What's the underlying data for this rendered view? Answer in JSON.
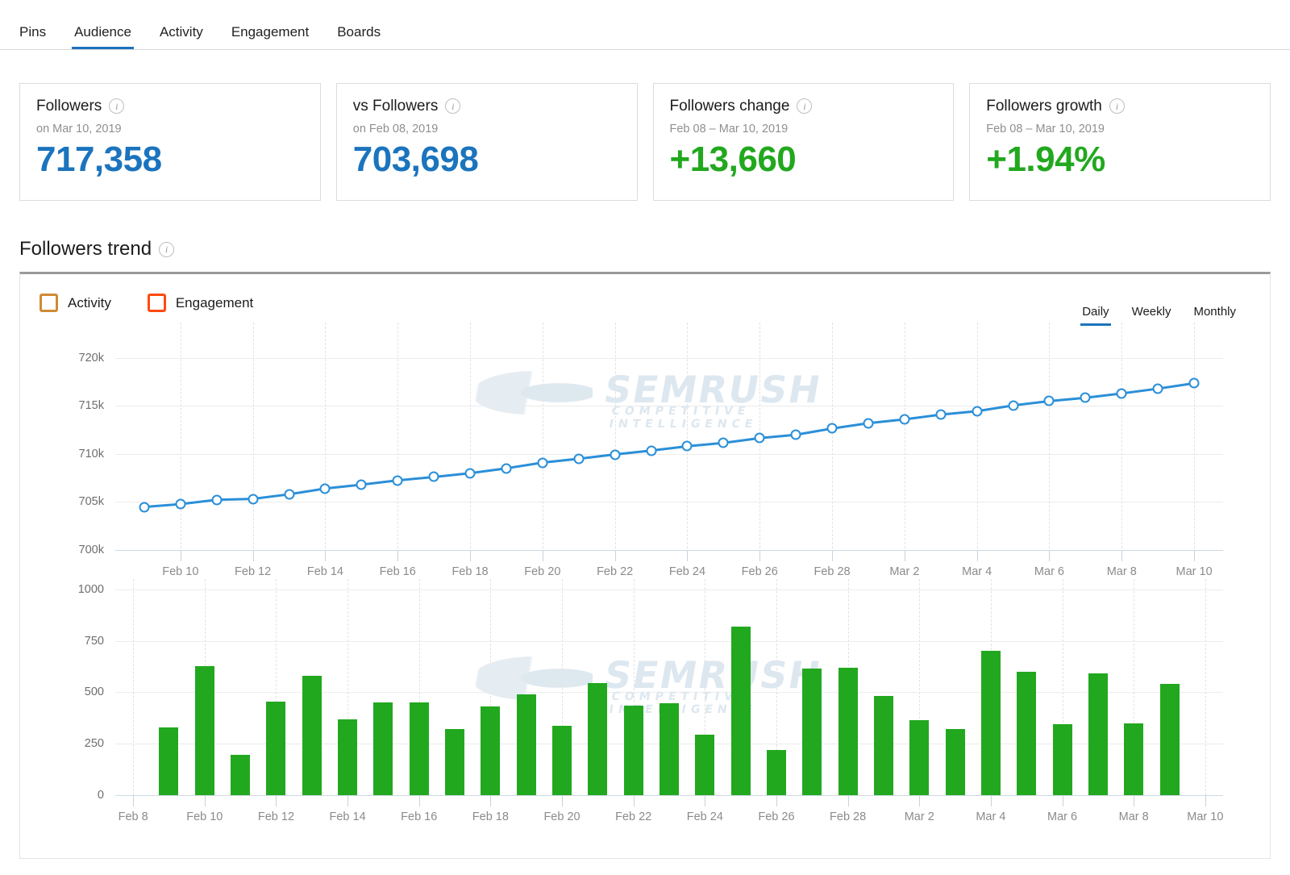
{
  "tabs": [
    {
      "label": "Pins",
      "active": false
    },
    {
      "label": "Audience",
      "active": true
    },
    {
      "label": "Activity",
      "active": false
    },
    {
      "label": "Engagement",
      "active": false
    },
    {
      "label": "Boards",
      "active": false
    }
  ],
  "kpis": [
    {
      "title": "Followers",
      "sub": "on Mar 10, 2019",
      "value": "717,358",
      "color": "#1b74bd",
      "info": "i"
    },
    {
      "title": "vs Followers",
      "sub": "on Feb 08, 2019",
      "value": "703,698",
      "color": "#1b74bd",
      "info": "i"
    },
    {
      "title": "Followers change",
      "sub": "Feb 08 – Mar 10, 2019",
      "value": "+13,660",
      "color": "#22a81f",
      "info": "i"
    },
    {
      "title": "Followers growth",
      "sub": "Feb 08 – Mar 10, 2019",
      "value": "+1.94%",
      "color": "#22a81f",
      "info": "i"
    }
  ],
  "section": {
    "title": "Followers trend",
    "info": "i"
  },
  "legend": [
    {
      "label": "Activity",
      "color": "#d08a35"
    },
    {
      "label": "Engagement",
      "color": "#ff4a11"
    }
  ],
  "granularity": [
    {
      "label": "Daily",
      "active": true
    },
    {
      "label": "Weekly",
      "active": false
    },
    {
      "label": "Monthly",
      "active": false
    }
  ],
  "watermark": {
    "main": "semrush",
    "sub": "COMPETITIVE INTELLIGENCE"
  },
  "colors": {
    "accent_blue": "#1b74bd",
    "line_blue": "#2b8fd8",
    "bar_green": "#22a81f",
    "grid": "#ececec",
    "axis": "#cfd8e2"
  },
  "chart_data": [
    {
      "type": "line",
      "title": "Followers trend",
      "xlabel": "",
      "ylabel": "",
      "ylim": [
        700000,
        722000
      ],
      "yticks": [
        700000,
        705000,
        710000,
        715000,
        720000
      ],
      "ytick_labels": [
        "700k",
        "705k",
        "710k",
        "715k",
        "720k"
      ],
      "grid": true,
      "legend_position": "top-left",
      "x": [
        "Feb 9",
        "Feb 10",
        "Feb 11",
        "Feb 12",
        "Feb 13",
        "Feb 14",
        "Feb 15",
        "Feb 16",
        "Feb 17",
        "Feb 18",
        "Feb 19",
        "Feb 20",
        "Feb 21",
        "Feb 22",
        "Feb 23",
        "Feb 24",
        "Feb 25",
        "Feb 26",
        "Feb 27",
        "Feb 28",
        "Mar 1",
        "Mar 2",
        "Mar 3",
        "Mar 4",
        "Mar 5",
        "Mar 6",
        "Mar 7",
        "Mar 8",
        "Mar 9",
        "Mar 10"
      ],
      "xtick_labels": [
        "Feb 10",
        "Feb 12",
        "Feb 14",
        "Feb 16",
        "Feb 18",
        "Feb 20",
        "Feb 22",
        "Feb 24",
        "Feb 26",
        "Feb 28",
        "Mar 2",
        "Mar 4",
        "Mar 6",
        "Mar 8",
        "Mar 10"
      ],
      "series": [
        {
          "name": "Followers",
          "color": "#2b8fd8",
          "values": [
            704480,
            704780,
            705230,
            705320,
            705800,
            706400,
            706800,
            707250,
            707600,
            708000,
            708500,
            709100,
            709500,
            709950,
            710350,
            710800,
            711150,
            711650,
            712000,
            712650,
            713200,
            713600,
            714100,
            714450,
            715050,
            715500,
            715850,
            716300,
            716800,
            717358
          ]
        }
      ]
    },
    {
      "type": "bar",
      "title": "",
      "xlabel": "",
      "ylabel": "",
      "ylim": [
        0,
        1050
      ],
      "yticks": [
        0,
        250,
        500,
        750,
        1000
      ],
      "ytick_labels": [
        "0",
        "250",
        "500",
        "750",
        "1000"
      ],
      "grid": true,
      "color": "#22a81f",
      "categories": [
        "Feb 8",
        "Feb 9",
        "Feb 10",
        "Feb 11",
        "Feb 12",
        "Feb 13",
        "Feb 14",
        "Feb 15",
        "Feb 16",
        "Feb 17",
        "Feb 18",
        "Feb 19",
        "Feb 20",
        "Feb 21",
        "Feb 22",
        "Feb 23",
        "Feb 24",
        "Feb 25",
        "Feb 26",
        "Feb 27",
        "Feb 28",
        "Mar 1",
        "Mar 2",
        "Mar 3",
        "Mar 4",
        "Mar 5",
        "Mar 6",
        "Mar 7",
        "Mar 8",
        "Mar 9",
        "Mar 10"
      ],
      "xtick_labels": [
        "Feb 8",
        "Feb 10",
        "Feb 12",
        "Feb 14",
        "Feb 16",
        "Feb 18",
        "Feb 20",
        "Feb 22",
        "Feb 24",
        "Feb 26",
        "Feb 28",
        "Mar 2",
        "Mar 4",
        "Mar 6",
        "Mar 8",
        "Mar 10"
      ],
      "values": [
        null,
        330,
        625,
        195,
        455,
        580,
        370,
        450,
        450,
        320,
        430,
        490,
        335,
        545,
        435,
        445,
        295,
        820,
        220,
        615,
        620,
        480,
        365,
        320,
        700,
        600,
        345,
        590,
        350,
        540,
        null
      ]
    }
  ]
}
